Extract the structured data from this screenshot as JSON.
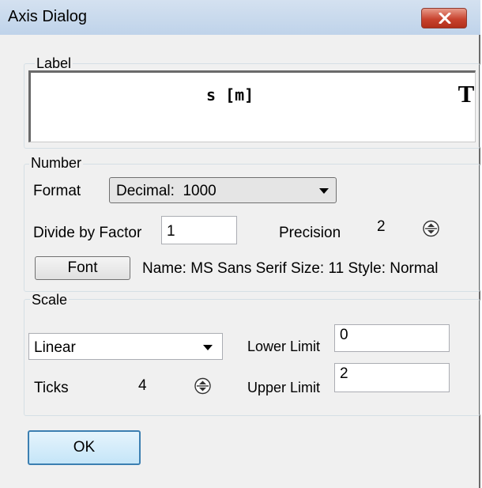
{
  "window": {
    "title": "Axis Dialog"
  },
  "label_group": {
    "legend": "Label",
    "text": "s [m]",
    "format_glyph": "T"
  },
  "number_group": {
    "legend": "Number",
    "format_label": "Format",
    "format_value": "Decimal:  1000",
    "divide_label": "Divide by Factor",
    "divide_value": "1",
    "precision_label": "Precision",
    "precision_value": "2",
    "font_button": "Font",
    "font_info": "Name: MS Sans Serif Size: 11 Style: Normal"
  },
  "scale_group": {
    "legend": "Scale",
    "scale_type": "Linear",
    "ticks_label": "Ticks",
    "ticks_value": "4",
    "lower_label": "Lower Limit",
    "lower_value": "0",
    "upper_label": "Upper Limit",
    "upper_value": "2"
  },
  "buttons": {
    "ok": "OK"
  },
  "colors": {
    "titlebar": "#bfd3ea",
    "close_button": "#c8432f",
    "ok_border": "#3c7fb1"
  }
}
